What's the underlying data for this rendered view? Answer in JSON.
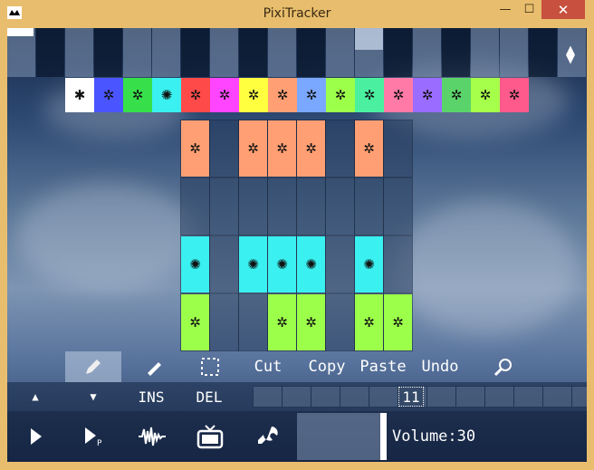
{
  "window": {
    "title": "PixiTracker",
    "minimize_glyph": "—",
    "maximize_glyph": "☐",
    "close_glyph": "✕"
  },
  "piano": {
    "keys": [
      "w",
      "b",
      "w",
      "b",
      "w",
      "w",
      "b",
      "w",
      "b",
      "w",
      "b",
      "w",
      "w",
      "b",
      "w",
      "b",
      "w",
      "w",
      "b",
      "w"
    ],
    "scroll_up": "▲",
    "scroll_down": "▼"
  },
  "instruments": [
    {
      "name": "instrument-1-icon",
      "color": "#ffffff",
      "glyph": "✱"
    },
    {
      "name": "instrument-2-icon",
      "color": "#4a55ff",
      "glyph": "✲"
    },
    {
      "name": "instrument-3-icon",
      "color": "#37e04a",
      "glyph": "✲"
    },
    {
      "name": "instrument-4-icon",
      "color": "#3af0f0",
      "glyph": "✺"
    },
    {
      "name": "instrument-5-icon",
      "color": "#ff4a4a",
      "glyph": "✲"
    },
    {
      "name": "instrument-6-icon",
      "color": "#ff45ff",
      "glyph": "✲"
    },
    {
      "name": "instrument-7-icon",
      "color": "#ffff40",
      "glyph": "✲"
    },
    {
      "name": "instrument-8-icon",
      "color": "#ff9f73",
      "glyph": "✲"
    },
    {
      "name": "instrument-9-icon",
      "color": "#7aa7ff",
      "glyph": "✲"
    },
    {
      "name": "instrument-10-icon",
      "color": "#9cff4a",
      "glyph": "✲"
    },
    {
      "name": "instrument-11-icon",
      "color": "#4af0a0",
      "glyph": "✲"
    },
    {
      "name": "instrument-12-icon",
      "color": "#ff7aa7",
      "glyph": "✲"
    },
    {
      "name": "instrument-13-icon",
      "color": "#9a6cff",
      "glyph": "✲"
    },
    {
      "name": "instrument-14-icon",
      "color": "#5ad46a",
      "glyph": "✲"
    },
    {
      "name": "instrument-15-icon",
      "color": "#a6ff4a",
      "glyph": "✲"
    },
    {
      "name": "instrument-16-icon",
      "color": "#ff5a8c",
      "glyph": "✲"
    }
  ],
  "grid": {
    "rows": [
      {
        "color": "#ff9f73",
        "glyph": "✲",
        "filled": [
          1,
          0,
          1,
          1,
          1,
          0,
          1,
          0
        ]
      },
      {
        "color": "",
        "glyph": "",
        "filled": [
          0,
          0,
          0,
          0,
          0,
          0,
          0,
          0
        ]
      },
      {
        "color": "#3af0f0",
        "glyph": "✺",
        "filled": [
          1,
          0,
          1,
          1,
          1,
          0,
          1,
          0
        ]
      },
      {
        "color": "#9cff4a",
        "glyph": "✲",
        "filled": [
          1,
          0,
          0,
          1,
          1,
          0,
          1,
          1
        ]
      }
    ]
  },
  "toolbar": {
    "cut": "Cut",
    "copy": "Copy",
    "paste": "Paste",
    "undo": "Undo"
  },
  "row2": {
    "up": "▲",
    "down": "▼",
    "ins": "INS",
    "del": "DEL",
    "current_measure": "11"
  },
  "row3": {
    "volume_label": "Volume:30",
    "volume_value": 30
  }
}
